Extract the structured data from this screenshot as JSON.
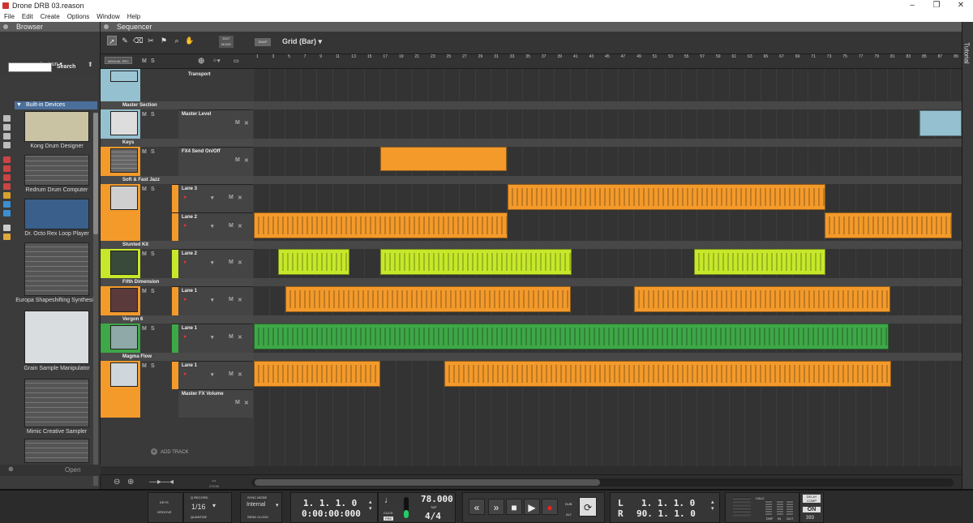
{
  "window": {
    "title": "Drone DRB 03.reason"
  },
  "menu": [
    "File",
    "Edit",
    "Create",
    "Options",
    "Window",
    "Help"
  ],
  "browser": {
    "title": "Browser",
    "instrument_filter": "Instrun",
    "search_label": "Search",
    "section": "Built-in Devices",
    "devices": [
      "Kong Drum Designer",
      "Redrum Drum Computer",
      "Dr. Octo Rex Loop Player",
      "Europa Shapeshifting Synthesi...",
      "Grain Sample Manipulator",
      "Mimic Creative Sampler"
    ],
    "open_label": "Open"
  },
  "sequencer": {
    "title": "Sequencer",
    "edit_mode": "EDIT MODE",
    "snap": "SNAP",
    "grid": "Grid (Bar)",
    "manual_rec": "MANUAL REC",
    "add_track": "ADD TRACK",
    "zoom_label": "ZOOM",
    "ruler_ticks": [
      "1",
      "3",
      "5",
      "7",
      "9",
      "11",
      "13",
      "15",
      "17",
      "19",
      "21",
      "23",
      "25",
      "27",
      "29",
      "31",
      "33",
      "35",
      "37",
      "39",
      "41",
      "43",
      "45",
      "47",
      "49",
      "51",
      "53",
      "55",
      "57",
      "59",
      "61",
      "63",
      "65",
      "67",
      "69",
      "71",
      "73",
      "75",
      "77",
      "79",
      "81",
      "83",
      "85",
      "87",
      "89"
    ],
    "tracks": [
      {
        "name": "Transport",
        "lanes": []
      },
      {
        "name": "Master Section",
        "lanes": [
          "Master Level"
        ]
      },
      {
        "name": "Keys",
        "lanes": [
          "FX4 Send On/Off"
        ]
      },
      {
        "name": "Soft & Fast Jazz",
        "lanes": [
          "Lane 3",
          "Lane 2"
        ]
      },
      {
        "name": "Stunted Kit",
        "lanes": [
          "Lane 2"
        ]
      },
      {
        "name": "Fifth Dimension",
        "lanes": [
          "Lane 1"
        ]
      },
      {
        "name": "Vergon 6",
        "lanes": [
          "Lane 1"
        ]
      },
      {
        "name": "Magma Flow",
        "lanes": [
          "Lane 1",
          "Master FX Volume"
        ]
      }
    ]
  },
  "tutorial": {
    "label": "Tutorial"
  },
  "transport": {
    "keys": "KEYS",
    "groove": "GROOVE",
    "q_record": "Q RECORD",
    "quantize_value": "1/16",
    "quantize": "QUANTIZE",
    "sync_mode_label": "SYNC MODE",
    "sync_mode": "Internal",
    "send_clock": "SEND CLOCK",
    "position_bars": "1.  1.  1.    0",
    "position_time": "0:00:00:000",
    "click": "CLICK",
    "pre": "PRE",
    "tempo": "78.000",
    "tap": "TAP",
    "signature": "4/4",
    "dub": "DUB",
    "alt": "ALT",
    "loop_l_label": "L",
    "loop_r_label": "R",
    "loop_l": "1.  1.  1.    0",
    "loop_r": "90.  1.  1.    0",
    "calc": "CALC",
    "dsp": "DSP",
    "in": "IN",
    "out": "OUT",
    "delay_comp": "DELAY COMP",
    "delay_on": "ON",
    "delay_value": "393"
  }
}
